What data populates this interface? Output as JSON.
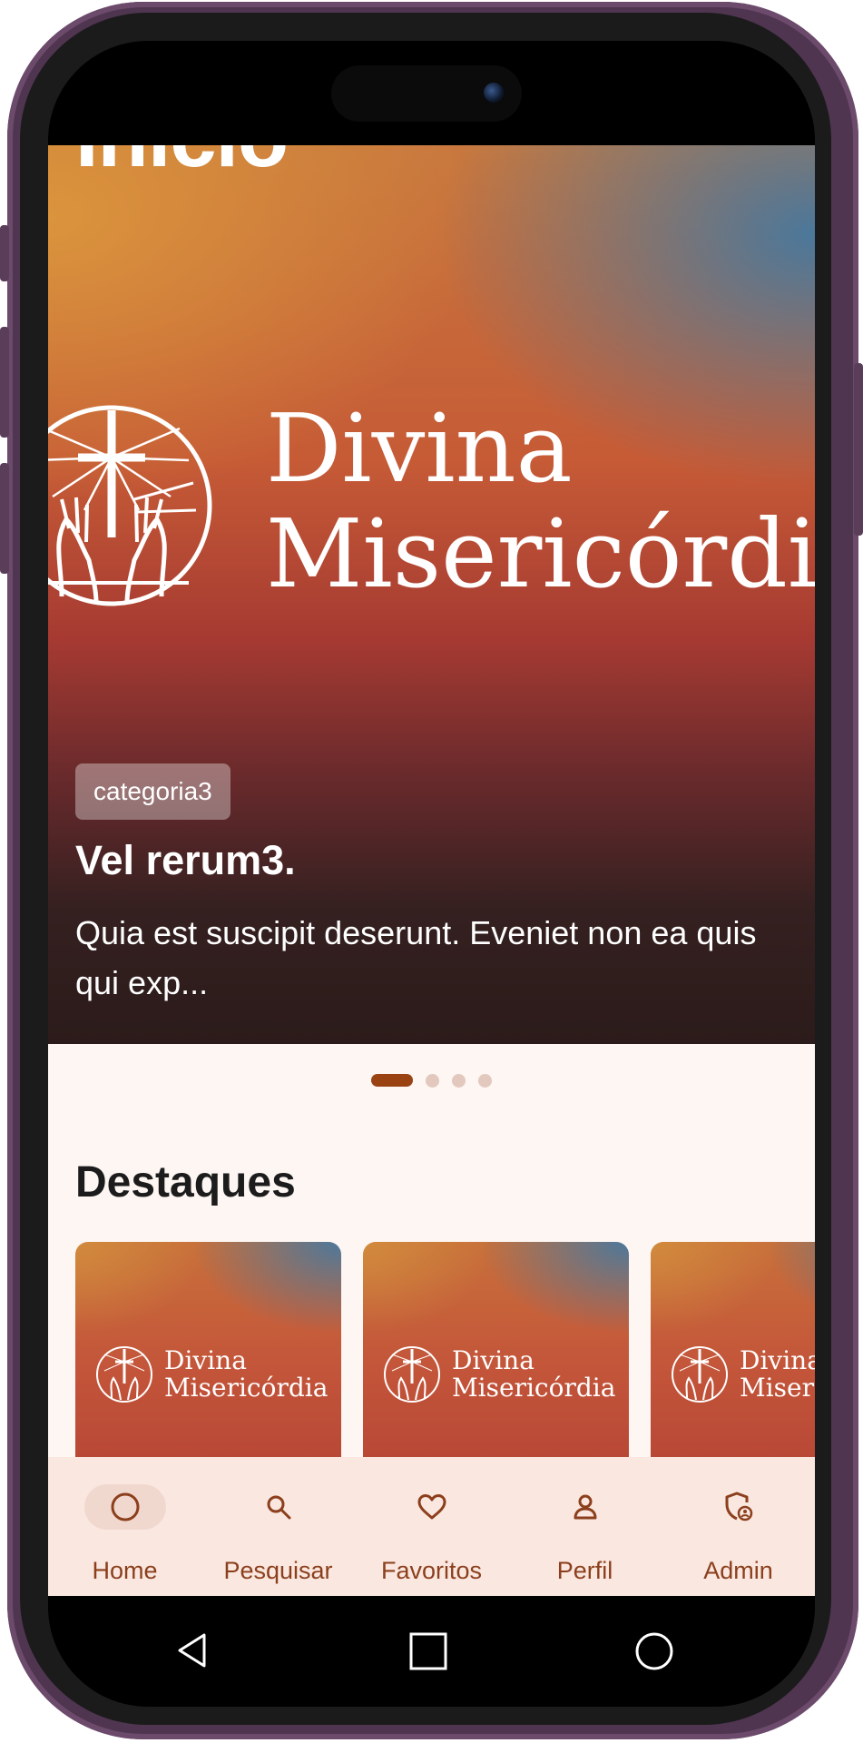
{
  "hero": {
    "title": "Início",
    "brand_line1": "Divina",
    "brand_line2": "Misericórdia",
    "category": "categoria3",
    "post_title": "Vel rerum3.",
    "post_description": "Quia est suscipit deserunt. Eveniet non ea quis qui exp..."
  },
  "carousel": {
    "count": 4,
    "active_index": 0,
    "active_color": "#9a4212",
    "inactive_color": "#e3c8be"
  },
  "featured": {
    "title": "Destaques",
    "cards": [
      {
        "brand_line1": "Divina",
        "brand_line2": "Misericórdia"
      },
      {
        "brand_line1": "Divina",
        "brand_line2": "Misericórdia"
      },
      {
        "brand_line1": "Divina",
        "brand_line2": "Misericórdia"
      }
    ]
  },
  "bottom_nav": {
    "items": [
      {
        "label": "Home",
        "icon": "home-icon",
        "active": true
      },
      {
        "label": "Pesquisar",
        "icon": "search-icon",
        "active": false
      },
      {
        "label": "Favoritos",
        "icon": "heart-icon",
        "active": false
      },
      {
        "label": "Perfil",
        "icon": "profile-icon",
        "active": false
      },
      {
        "label": "Admin",
        "icon": "admin-icon",
        "active": false
      }
    ]
  },
  "system_nav": {
    "icons": [
      "back-icon",
      "home-square-icon",
      "recents-circle-icon"
    ]
  },
  "colors": {
    "accent": "#8c3f1c",
    "background": "#fdf6f3",
    "nav_background": "#f9e7e0"
  }
}
